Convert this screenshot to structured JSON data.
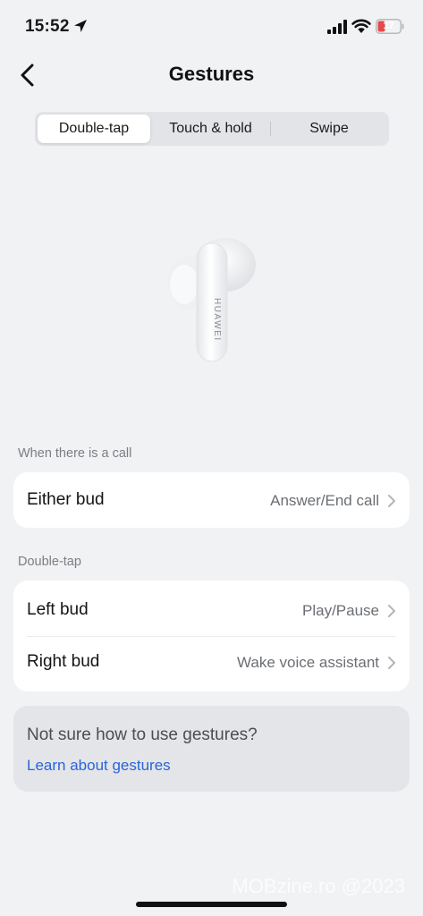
{
  "status_bar": {
    "time": "15:52",
    "battery": "17",
    "icons": [
      "location-arrow-icon",
      "cellular-signal-icon",
      "wifi-icon",
      "battery-icon"
    ]
  },
  "header": {
    "title": "Gestures",
    "back_icon": "chevron-left-icon"
  },
  "segments": {
    "items": [
      "Double-tap",
      "Touch & hold",
      "Swipe"
    ],
    "selected": "Double-tap"
  },
  "illustration": {
    "brand_text": "HUAWEI"
  },
  "call_section": {
    "label": "When there is a call",
    "rows": [
      {
        "label": "Either bud",
        "value": "Answer/End call"
      }
    ]
  },
  "doubletap_section": {
    "label": "Double-tap",
    "rows": [
      {
        "label": "Left bud",
        "value": "Play/Pause"
      },
      {
        "label": "Right bud",
        "value": "Wake voice assistant"
      }
    ]
  },
  "help": {
    "title": "Not sure how to use gestures?",
    "link": "Learn about gestures"
  },
  "watermark": "MOBzine.ro @2023",
  "colors": {
    "background": "#f1f2f4",
    "card": "#ffffff",
    "link": "#2b64d9",
    "battery_low": "#e5484d"
  }
}
